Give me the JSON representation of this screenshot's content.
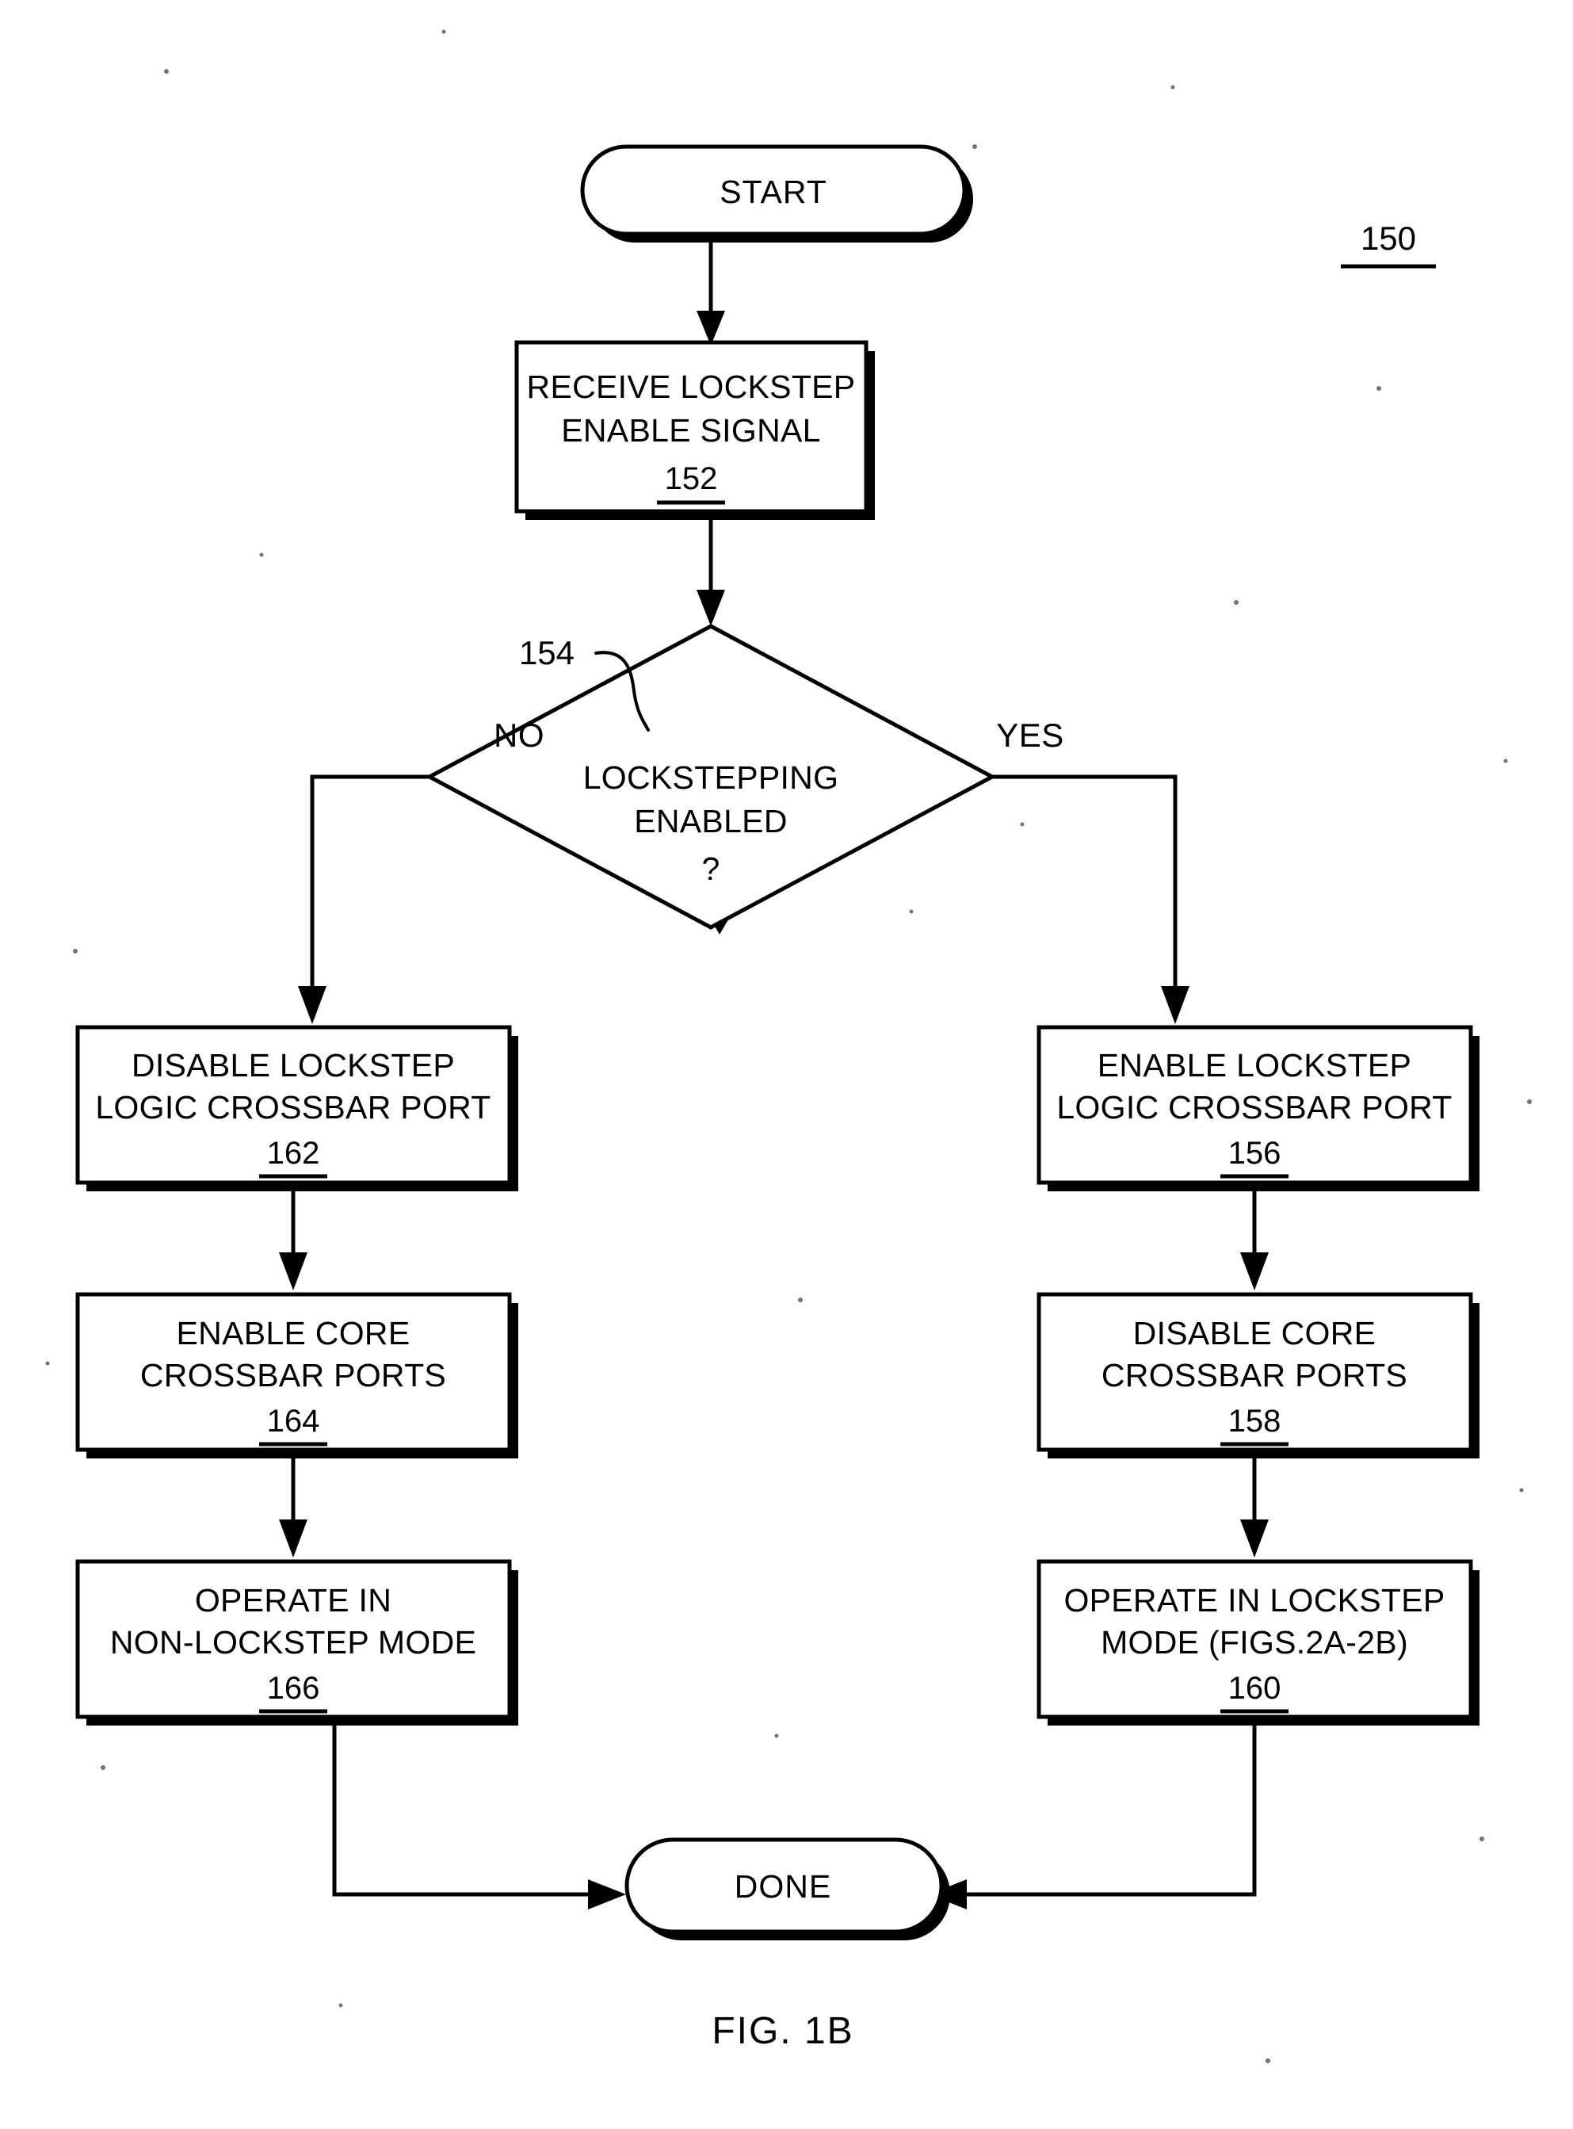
{
  "figure": {
    "caption": "FIG. 1B",
    "reference_numeral": "150"
  },
  "nodes": {
    "start": {
      "label": "START",
      "type": "terminator"
    },
    "done": {
      "label": "DONE",
      "type": "terminator"
    },
    "receive": {
      "type": "process",
      "line1": "RECEIVE LOCKSTEP",
      "line2": "ENABLE SIGNAL",
      "ref": "152"
    },
    "decision": {
      "type": "decision",
      "line1": "LOCKSTEPPING",
      "line2": "ENABLED",
      "line3": "?",
      "ref": "154"
    },
    "enable_lockstep_logic": {
      "type": "process",
      "line1": "ENABLE LOCKSTEP",
      "line2": "LOGIC CROSSBAR PORT",
      "ref": "156"
    },
    "disable_core_ports": {
      "type": "process",
      "line1": "DISABLE CORE",
      "line2": "CROSSBAR PORTS",
      "ref": "158"
    },
    "operate_lockstep": {
      "type": "process",
      "line1": "OPERATE IN LOCKSTEP",
      "line2": "MODE (FIGS.2A-2B)",
      "ref": "160"
    },
    "disable_lockstep_logic": {
      "type": "process",
      "line1": "DISABLE LOCKSTEP",
      "line2": "LOGIC CROSSBAR PORT",
      "ref": "162"
    },
    "enable_core_ports": {
      "type": "process",
      "line1": "ENABLE CORE",
      "line2": "CROSSBAR PORTS",
      "ref": "164"
    },
    "operate_non_lockstep": {
      "type": "process",
      "line1": "OPERATE IN",
      "line2": "NON-LOCKSTEP MODE",
      "ref": "166"
    }
  },
  "branches": {
    "no_label": "NO",
    "yes_label": "YES"
  },
  "colors": {
    "ink": "#000000",
    "paper": "#ffffff"
  }
}
